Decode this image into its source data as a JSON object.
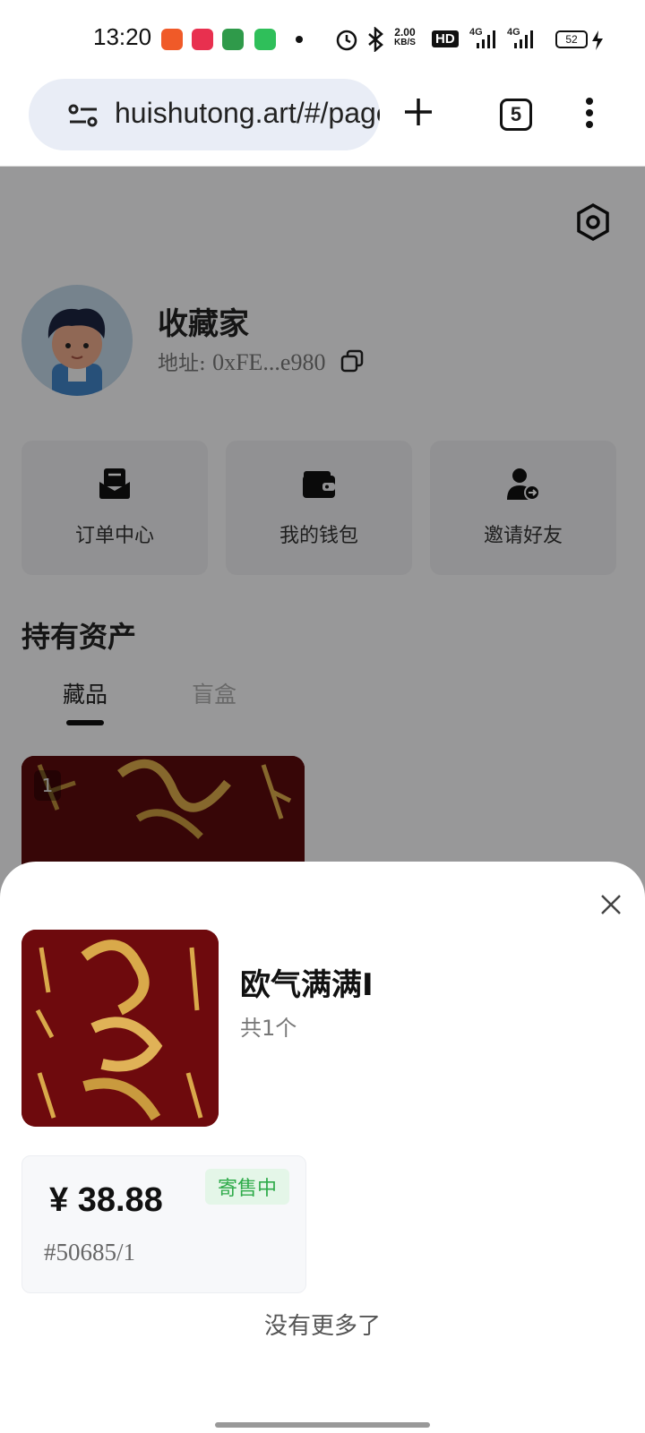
{
  "status_bar": {
    "time": "13:20",
    "network_speed_value": "2.00",
    "network_speed_unit": "KB/S",
    "hd_label": "HD",
    "signal_1": "4G",
    "signal_2": "4G",
    "battery": "52"
  },
  "browser": {
    "url": "huishutong.art/#/pages",
    "tab_count": "5"
  },
  "profile": {
    "nickname": "收藏家",
    "address_label": "地址:",
    "address_value": "0xFE...e980"
  },
  "quick_actions": [
    {
      "label": "订单中心",
      "icon": "order-icon"
    },
    {
      "label": "我的钱包",
      "icon": "wallet-icon"
    },
    {
      "label": "邀请好友",
      "icon": "invite-friend-icon"
    }
  ],
  "assets": {
    "title": "持有资产",
    "tabs": [
      {
        "label": "藏品",
        "active": true
      },
      {
        "label": "盲盒",
        "active": false
      }
    ],
    "card_badge": "1"
  },
  "sheet": {
    "item_name": "欧气满满I",
    "item_count": "共1个",
    "listing": {
      "price": "¥ 38.88",
      "status": "寄售中",
      "serial": "#50685/1"
    },
    "footer": "没有更多了"
  },
  "colors": {
    "badge_bg": "#e4f6e8",
    "badge_text": "#2fab4a",
    "artwork_red": "#6e0a0d",
    "artwork_gold": "#d9a94a"
  }
}
